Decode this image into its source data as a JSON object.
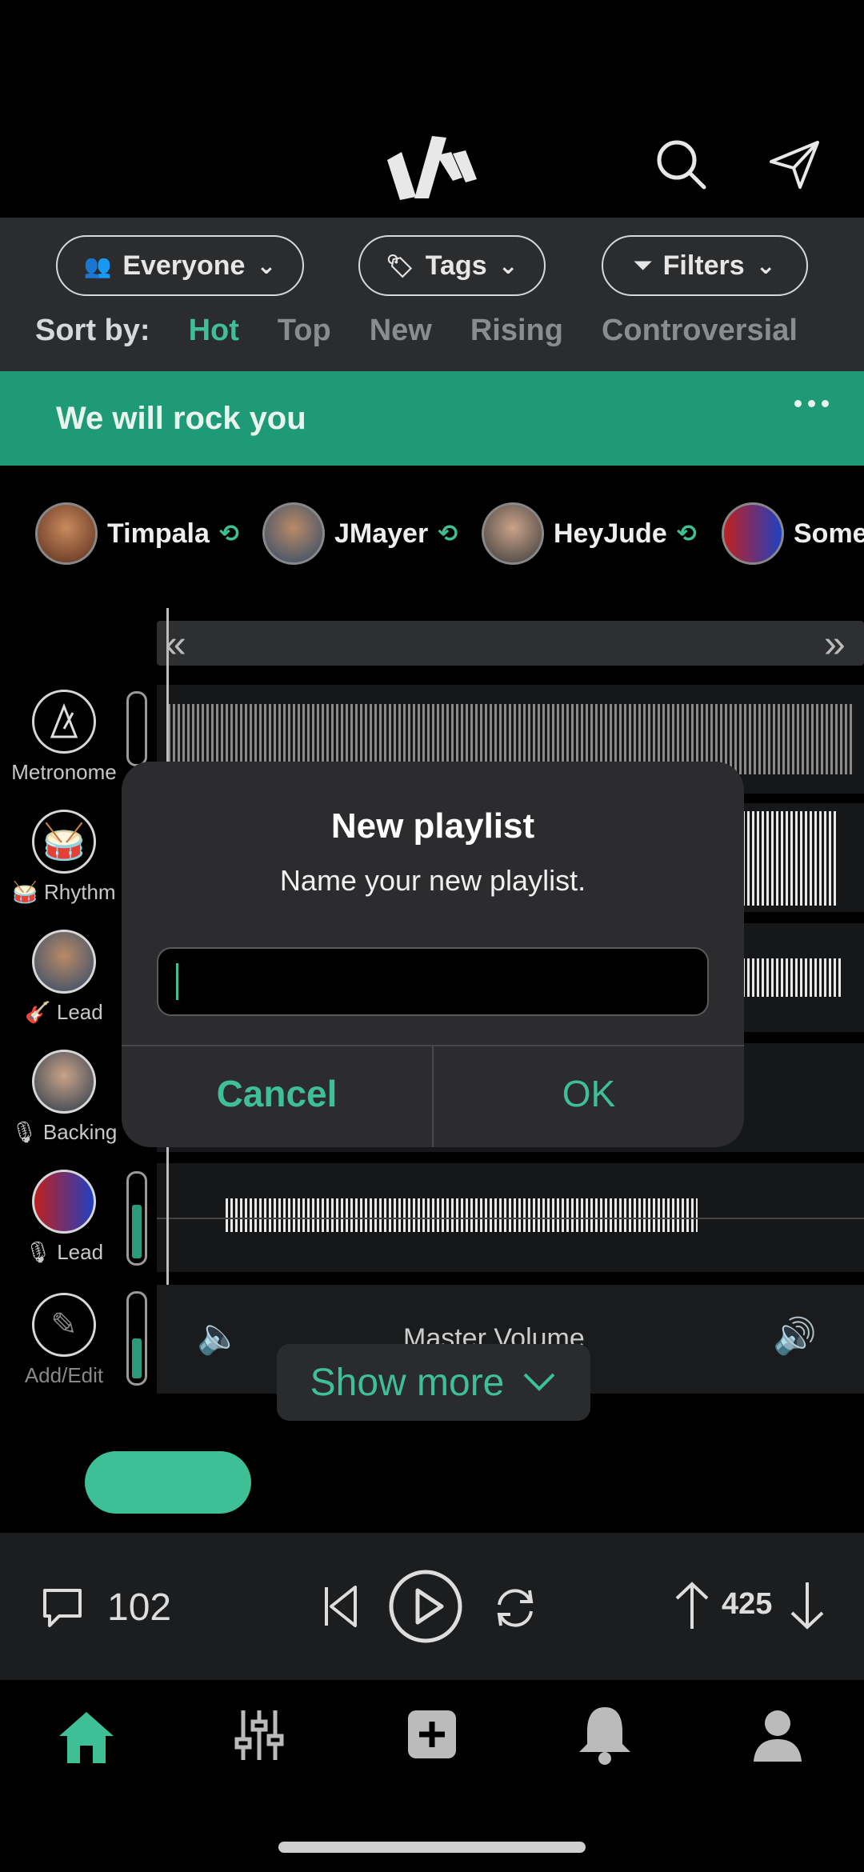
{
  "header": {
    "logo": "app-logo",
    "search_icon": "search-icon",
    "send_icon": "send-icon"
  },
  "filters": {
    "everyone_label": "Everyone",
    "tags_label": "Tags",
    "filters_label": "Filters"
  },
  "sort": {
    "label": "Sort by:",
    "options": [
      "Hot",
      "Top",
      "New",
      "Rising",
      "Controversial"
    ],
    "active": "Hot"
  },
  "post": {
    "title": "We will rock you"
  },
  "users": [
    {
      "name": "Timpala"
    },
    {
      "name": "JMayer"
    },
    {
      "name": "HeyJude"
    },
    {
      "name": "Some"
    }
  ],
  "tracks": [
    {
      "label": "Metronome"
    },
    {
      "label": "Rhythm"
    },
    {
      "label": "Lead"
    },
    {
      "label": "Backing"
    },
    {
      "label": "Lead"
    },
    {
      "label": "Add/Edit"
    }
  ],
  "mixer": {
    "master_label": "Master Volume"
  },
  "modal": {
    "title": "New playlist",
    "subtitle": "Name your new playlist.",
    "input_value": "",
    "cancel_label": "Cancel",
    "ok_label": "OK"
  },
  "show_more": {
    "label": "Show more"
  },
  "player": {
    "comments": "102",
    "votes": "425"
  },
  "colors": {
    "accent": "#3fbf95",
    "banner": "#1f9a76",
    "panel": "#2b2c2e"
  }
}
